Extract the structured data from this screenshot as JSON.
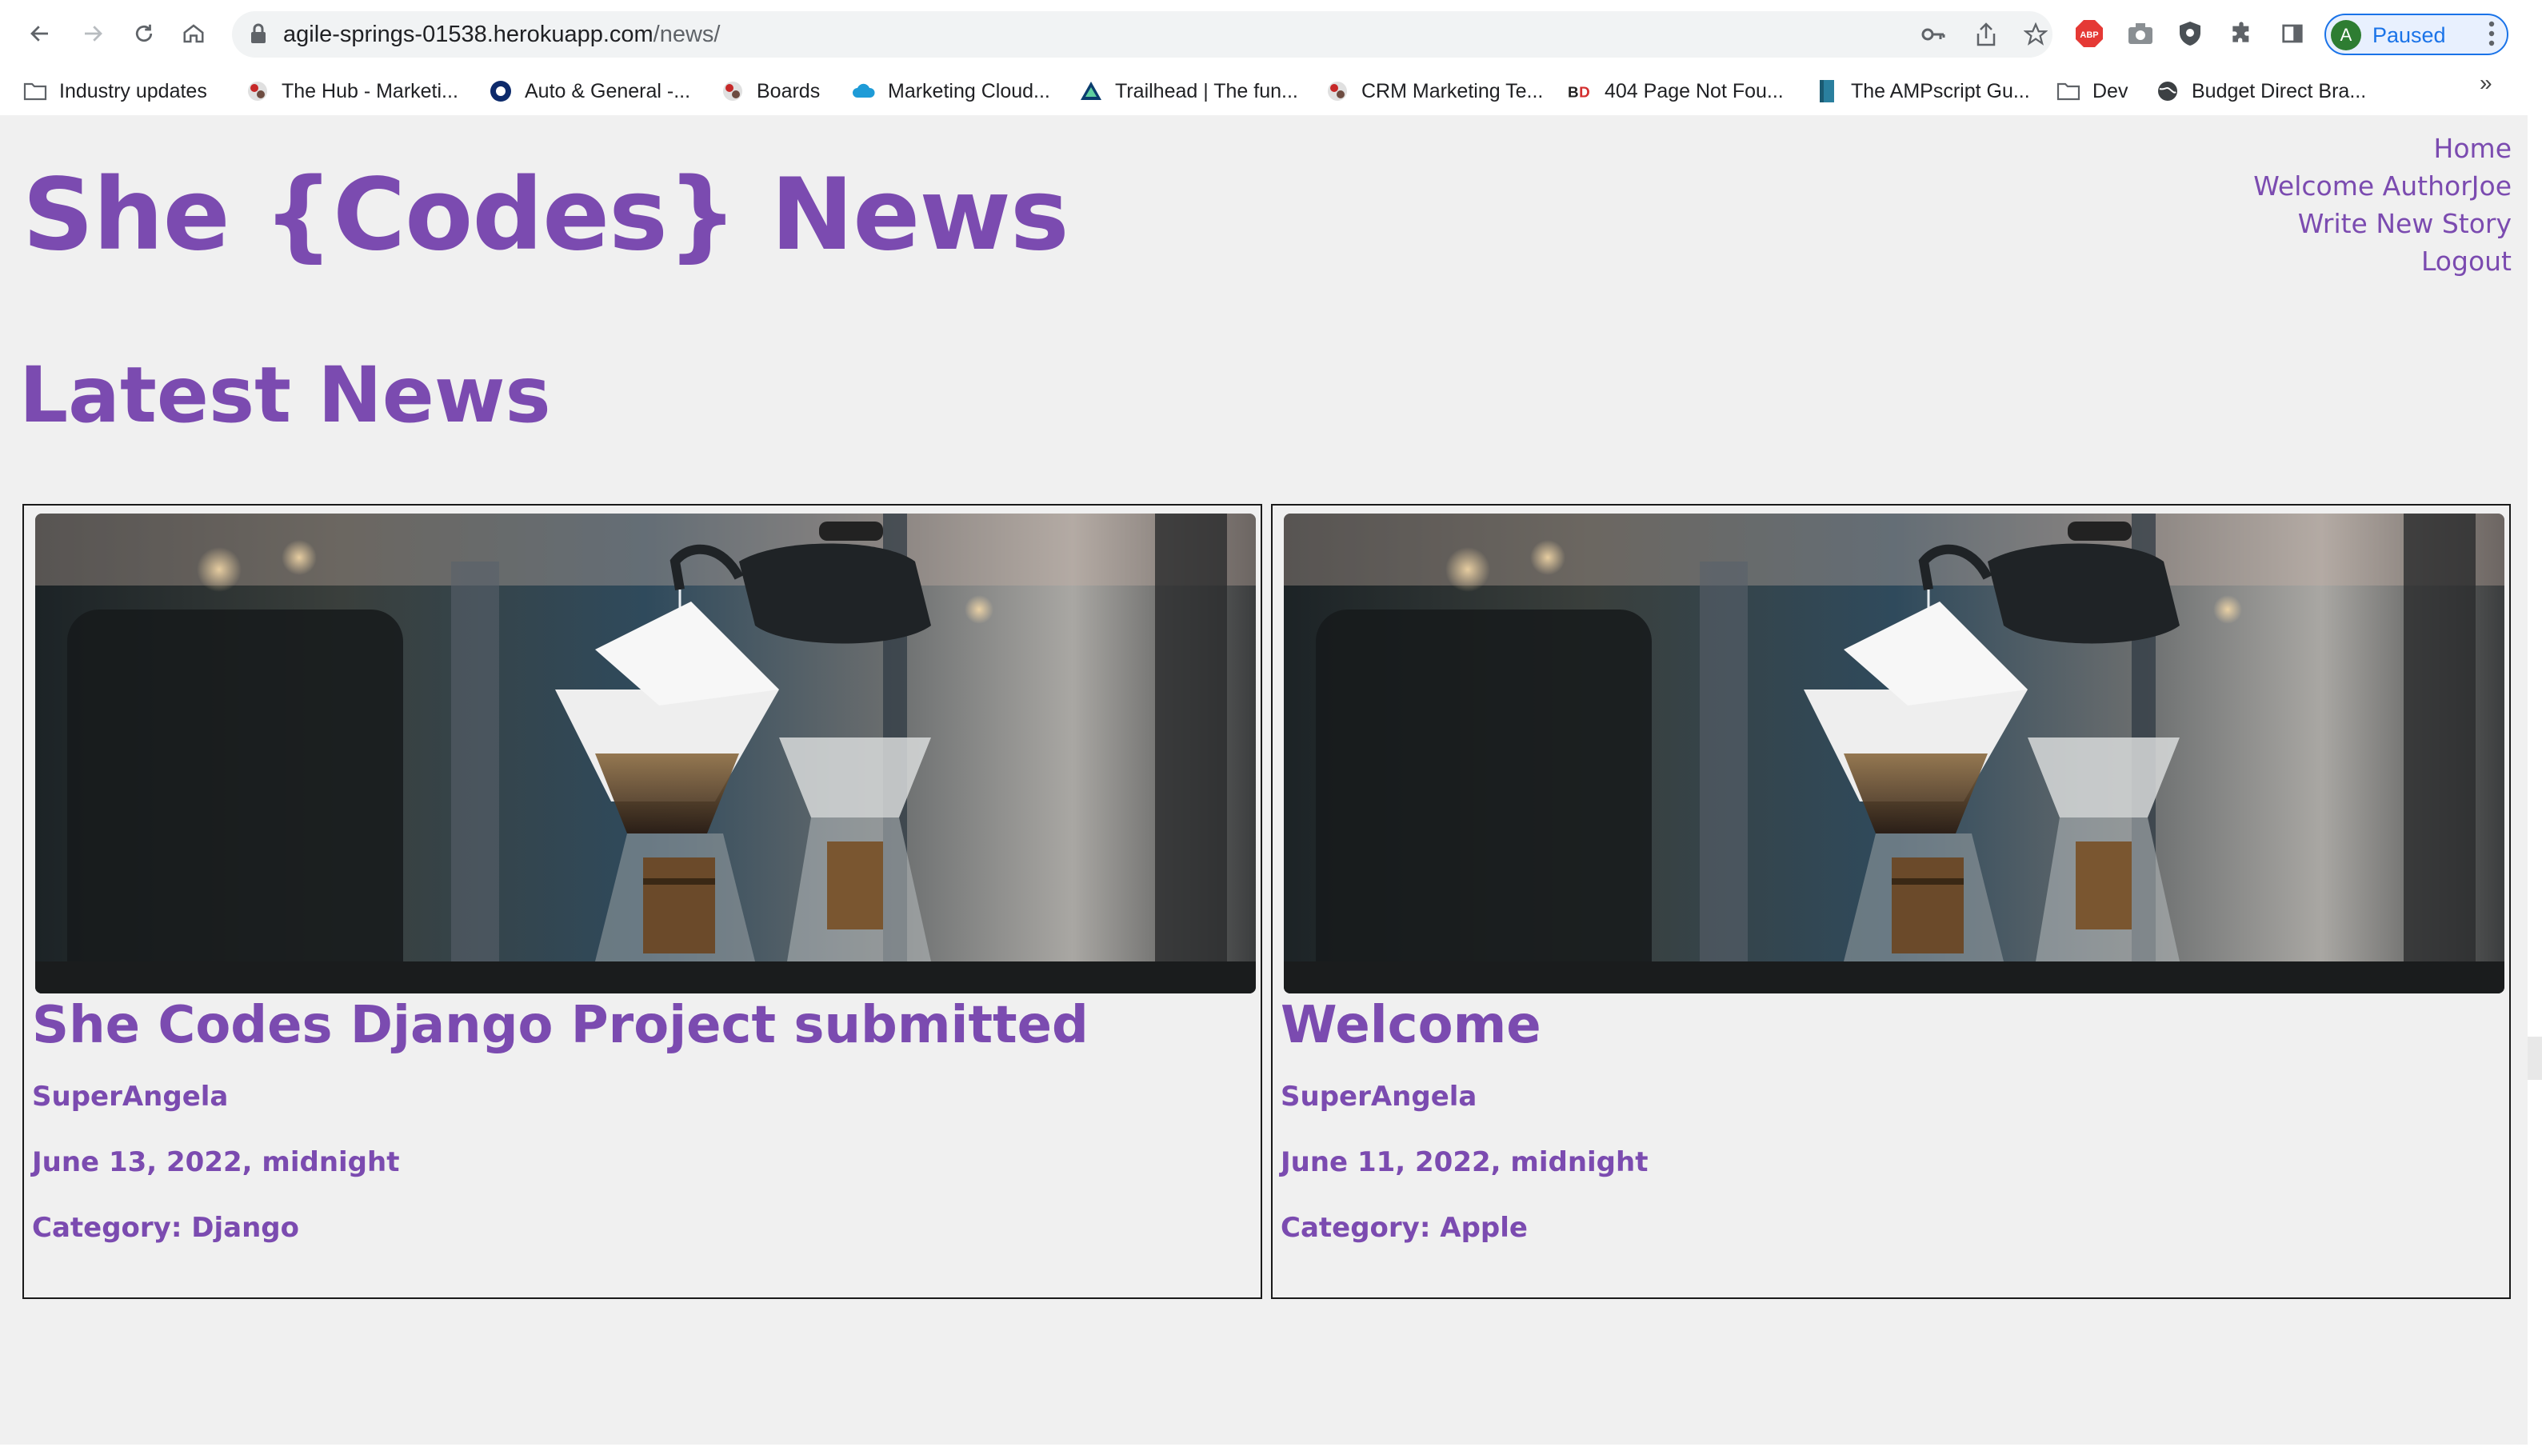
{
  "browser": {
    "url_host": "agile-springs-01538.herokuapp.com",
    "url_path": "/news/",
    "profile_initial": "A",
    "profile_status": "Paused",
    "bookmarks": [
      {
        "label": "Industry updates",
        "icon": "folder-icon"
      },
      {
        "label": "The Hub - Marketi...",
        "icon": "bookmark-favicon"
      },
      {
        "label": "Auto & General -...",
        "icon": "bookmark-favicon"
      },
      {
        "label": "Boards",
        "icon": "bookmark-favicon"
      },
      {
        "label": "Marketing Cloud...",
        "icon": "cloud-favicon"
      },
      {
        "label": "Trailhead | The fun...",
        "icon": "trailhead-favicon"
      },
      {
        "label": "CRM Marketing Te...",
        "icon": "bookmark-favicon"
      },
      {
        "label": "404 Page Not Fou...",
        "icon": "bd-favicon"
      },
      {
        "label": "The AMPscript Gu...",
        "icon": "book-favicon"
      },
      {
        "label": "Dev",
        "icon": "folder-icon"
      },
      {
        "label": "Budget Direct Bra...",
        "icon": "globe-icon"
      }
    ],
    "bookmarks_more": "»"
  },
  "site": {
    "title": "She {Codes} News",
    "nav": {
      "home": "Home",
      "welcome": "Welcome AuthorJoe",
      "write": "Write New Story",
      "logout": "Logout"
    },
    "section_title": "Latest News"
  },
  "stories": [
    {
      "title": "She Codes Django Project submitted",
      "author": "SuperAngela",
      "date": "June 13, 2022, midnight",
      "category_label": "Category:",
      "category": "Django"
    },
    {
      "title": "Welcome",
      "author": "SuperAngela",
      "date": "June 11, 2022, midnight",
      "category_label": "Category:",
      "category": "Apple"
    }
  ],
  "colors": {
    "accent": "#7b4bb0",
    "page_bg": "#f0f0f0",
    "card_border": "#1a1a1a"
  }
}
